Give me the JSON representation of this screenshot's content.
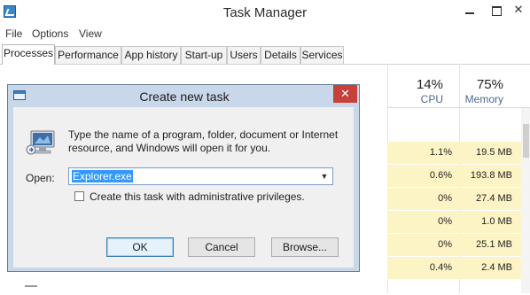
{
  "window": {
    "title": "Task Manager",
    "close_glyph": "✕"
  },
  "menu": {
    "file": "File",
    "options": "Options",
    "view": "View"
  },
  "tabs": [
    {
      "label": "Processes"
    },
    {
      "label": "Performance"
    },
    {
      "label": "App history"
    },
    {
      "label": "Start-up"
    },
    {
      "label": "Users"
    },
    {
      "label": "Details"
    },
    {
      "label": "Services"
    }
  ],
  "columns": {
    "cpu": {
      "percent": "14%",
      "label": "CPU"
    },
    "memory": {
      "percent": "75%",
      "label": "Memory"
    }
  },
  "rows": [
    {
      "cpu": "1.1%",
      "mem": "19.5 MB"
    },
    {
      "cpu": "0.6%",
      "mem": "193.8 MB"
    },
    {
      "cpu": "0%",
      "mem": "27.4 MB"
    },
    {
      "cpu": "0%",
      "mem": "1.0 MB"
    },
    {
      "cpu": "0%",
      "mem": "25.1 MB"
    },
    {
      "cpu": "0.4%",
      "mem": "2.4 MB"
    }
  ],
  "dialog": {
    "title": "Create new task",
    "close_glyph": "✕",
    "description_line1": "Type the name of a program, folder, document or Internet",
    "description_line2": "resource, and Windows will open it for you.",
    "open_label": "Open:",
    "open_value": "Explorer.exe",
    "admin_label": "Create this task with administrative privileges.",
    "admin_checked": false,
    "ok_label": "OK",
    "cancel_label": "Cancel",
    "browse_label": "Browse...",
    "combo_arrow_glyph": "▼"
  },
  "colors": {
    "accent": "#3399ff",
    "close_red": "#c7403a",
    "heat_cell": "#fdf4c5",
    "dialog_frame": "#c8d8ea"
  },
  "icons": {
    "app": "task-manager-icon",
    "dialog": "window-icon",
    "run": "run-program-icon"
  }
}
